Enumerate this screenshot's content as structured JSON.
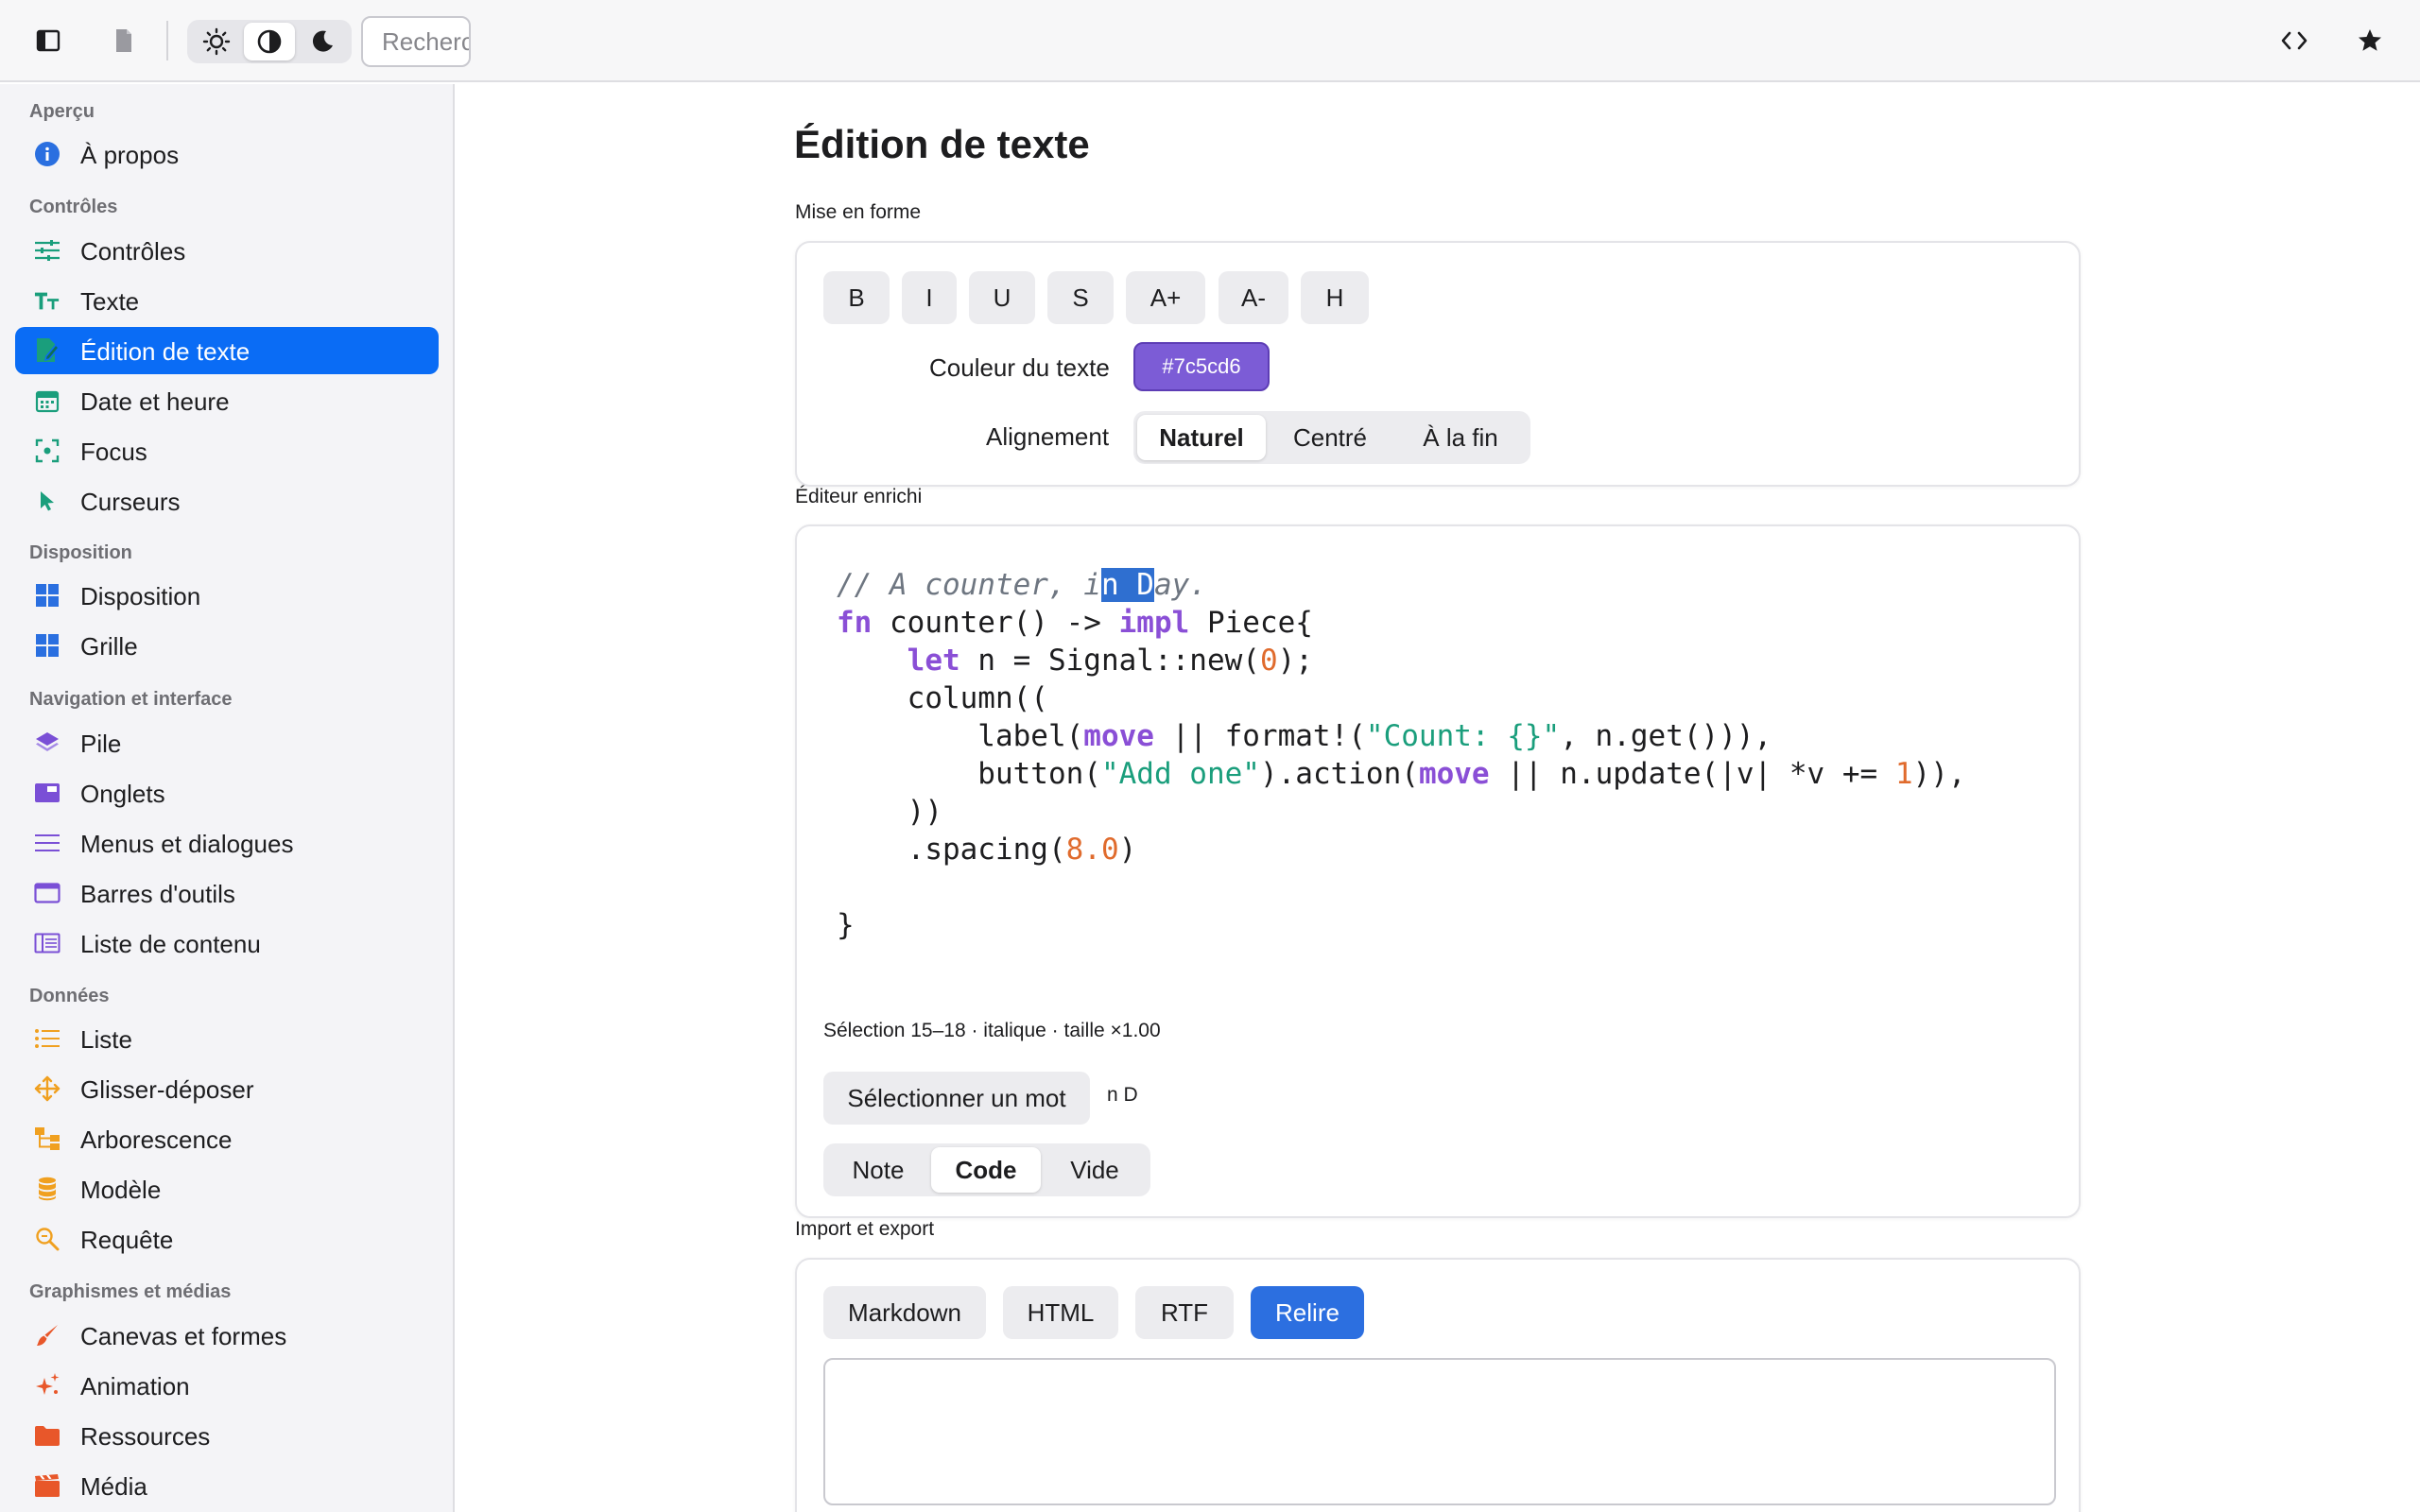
{
  "toolbar": {
    "search_placeholder": "Recherc",
    "icons": [
      "sidebar-icon",
      "document-icon",
      "sun-icon",
      "contrast-icon",
      "moon-icon",
      "code-icon",
      "star-icon"
    ]
  },
  "sidebar": {
    "sections": [
      {
        "title": "Aperçu",
        "items": [
          {
            "label": "À propos",
            "icon": "info-icon",
            "color": "#2a6fe0"
          }
        ]
      },
      {
        "title": "Contrôles",
        "items": [
          {
            "label": "Contrôles",
            "icon": "sliders-icon",
            "color": "#1a9e7c"
          },
          {
            "label": "Texte",
            "icon": "text-size-icon",
            "color": "#1a9e7c"
          },
          {
            "label": "Édition de texte",
            "icon": "edit-document-icon",
            "color": "#1a9e7c",
            "active": true
          },
          {
            "label": "Date et heure",
            "icon": "calendar-icon",
            "color": "#1a9e7c"
          },
          {
            "label": "Focus",
            "icon": "focus-icon",
            "color": "#1a9e7c"
          },
          {
            "label": "Curseurs",
            "icon": "cursor-icon",
            "color": "#1a9e7c"
          }
        ]
      },
      {
        "title": "Disposition",
        "items": [
          {
            "label": "Disposition",
            "icon": "layout-icon",
            "color": "#2a6fe0"
          },
          {
            "label": "Grille",
            "icon": "grid-icon",
            "color": "#2a6fe0"
          }
        ]
      },
      {
        "title": "Navigation et interface",
        "items": [
          {
            "label": "Pile",
            "icon": "stack-icon",
            "color": "#7a4fd6"
          },
          {
            "label": "Onglets",
            "icon": "tabs-icon",
            "color": "#7a4fd6"
          },
          {
            "label": "Menus et dialogues",
            "icon": "menu-icon",
            "color": "#7a4fd6"
          },
          {
            "label": "Barres d'outils",
            "icon": "toolbar-icon",
            "color": "#7a4fd6"
          },
          {
            "label": "Liste de contenu",
            "icon": "content-list-icon",
            "color": "#7a4fd6"
          }
        ]
      },
      {
        "title": "Données",
        "items": [
          {
            "label": "Liste",
            "icon": "list-icon",
            "color": "#f0a020"
          },
          {
            "label": "Glisser-déposer",
            "icon": "move-icon",
            "color": "#f0a020"
          },
          {
            "label": "Arborescence",
            "icon": "tree-icon",
            "color": "#f0a020"
          },
          {
            "label": "Modèle",
            "icon": "database-icon",
            "color": "#f0a020"
          },
          {
            "label": "Requête",
            "icon": "search-icon",
            "color": "#f0a020"
          }
        ]
      },
      {
        "title": "Graphismes et médias",
        "items": [
          {
            "label": "Canevas et formes",
            "icon": "brush-icon",
            "color": "#e8572a"
          },
          {
            "label": "Animation",
            "icon": "sparkle-icon",
            "color": "#e8572a"
          },
          {
            "label": "Ressources",
            "icon": "folder-icon",
            "color": "#e8572a"
          },
          {
            "label": "Média",
            "icon": "film-icon",
            "color": "#e8572a"
          }
        ]
      }
    ]
  },
  "main": {
    "title": "Édition de texte",
    "formatting": {
      "label": "Mise en forme",
      "buttons": [
        "B",
        "I",
        "U",
        "S",
        "A+",
        "A-",
        "H"
      ],
      "color_label": "Couleur du texte",
      "color_value": "#7c5cd6",
      "align_label": "Alignement",
      "align_options": [
        "Naturel",
        "Centré",
        "À la fin"
      ],
      "align_selected": "Naturel"
    },
    "editor": {
      "label": "Éditeur enrichi",
      "code_lines": [
        [
          {
            "t": "// A counter, i",
            "c": "com"
          },
          {
            "t": "n D",
            "c": "sel"
          },
          {
            "t": "ay.",
            "c": "com"
          }
        ],
        [
          {
            "t": "fn",
            "c": "kw"
          },
          {
            "t": " counter() -> ",
            "c": ""
          },
          {
            "t": "impl",
            "c": "kw"
          },
          {
            "t": " Piece{",
            "c": ""
          }
        ],
        [
          {
            "t": "    ",
            "c": ""
          },
          {
            "t": "let",
            "c": "kw"
          },
          {
            "t": " n = Signal::new(",
            "c": ""
          },
          {
            "t": "0",
            "c": "num"
          },
          {
            "t": ");",
            "c": ""
          }
        ],
        [
          {
            "t": "    column((",
            "c": ""
          }
        ],
        [
          {
            "t": "        label(",
            "c": ""
          },
          {
            "t": "move",
            "c": "kw"
          },
          {
            "t": " || format!(",
            "c": ""
          },
          {
            "t": "\"Count: {}\"",
            "c": "str"
          },
          {
            "t": ", n.get())),",
            "c": ""
          }
        ],
        [
          {
            "t": "        button(",
            "c": ""
          },
          {
            "t": "\"Add one\"",
            "c": "str"
          },
          {
            "t": ").action(",
            "c": ""
          },
          {
            "t": "move",
            "c": "kw"
          },
          {
            "t": " || n.update(|v| *v += ",
            "c": ""
          },
          {
            "t": "1",
            "c": "num"
          },
          {
            "t": ")),",
            "c": ""
          }
        ],
        [
          {
            "t": "    ))",
            "c": ""
          }
        ],
        [
          {
            "t": "    .spacing(",
            "c": ""
          },
          {
            "t": "8.0",
            "c": "num"
          },
          {
            "t": ")",
            "c": ""
          }
        ],
        [
          {
            "t": "",
            "c": ""
          }
        ],
        [
          {
            "t": "}",
            "c": ""
          }
        ]
      ],
      "status": "Sélection 15–18 · italique · taille ×1.00",
      "select_word_label": "Sélectionner un mot",
      "selected_text": "n D",
      "mode_options": [
        "Note",
        "Code",
        "Vide"
      ],
      "mode_selected": "Code"
    },
    "import_export": {
      "label": "Import et export",
      "buttons": [
        "Markdown",
        "HTML",
        "RTF",
        "Relire"
      ],
      "primary": "Relire"
    }
  }
}
